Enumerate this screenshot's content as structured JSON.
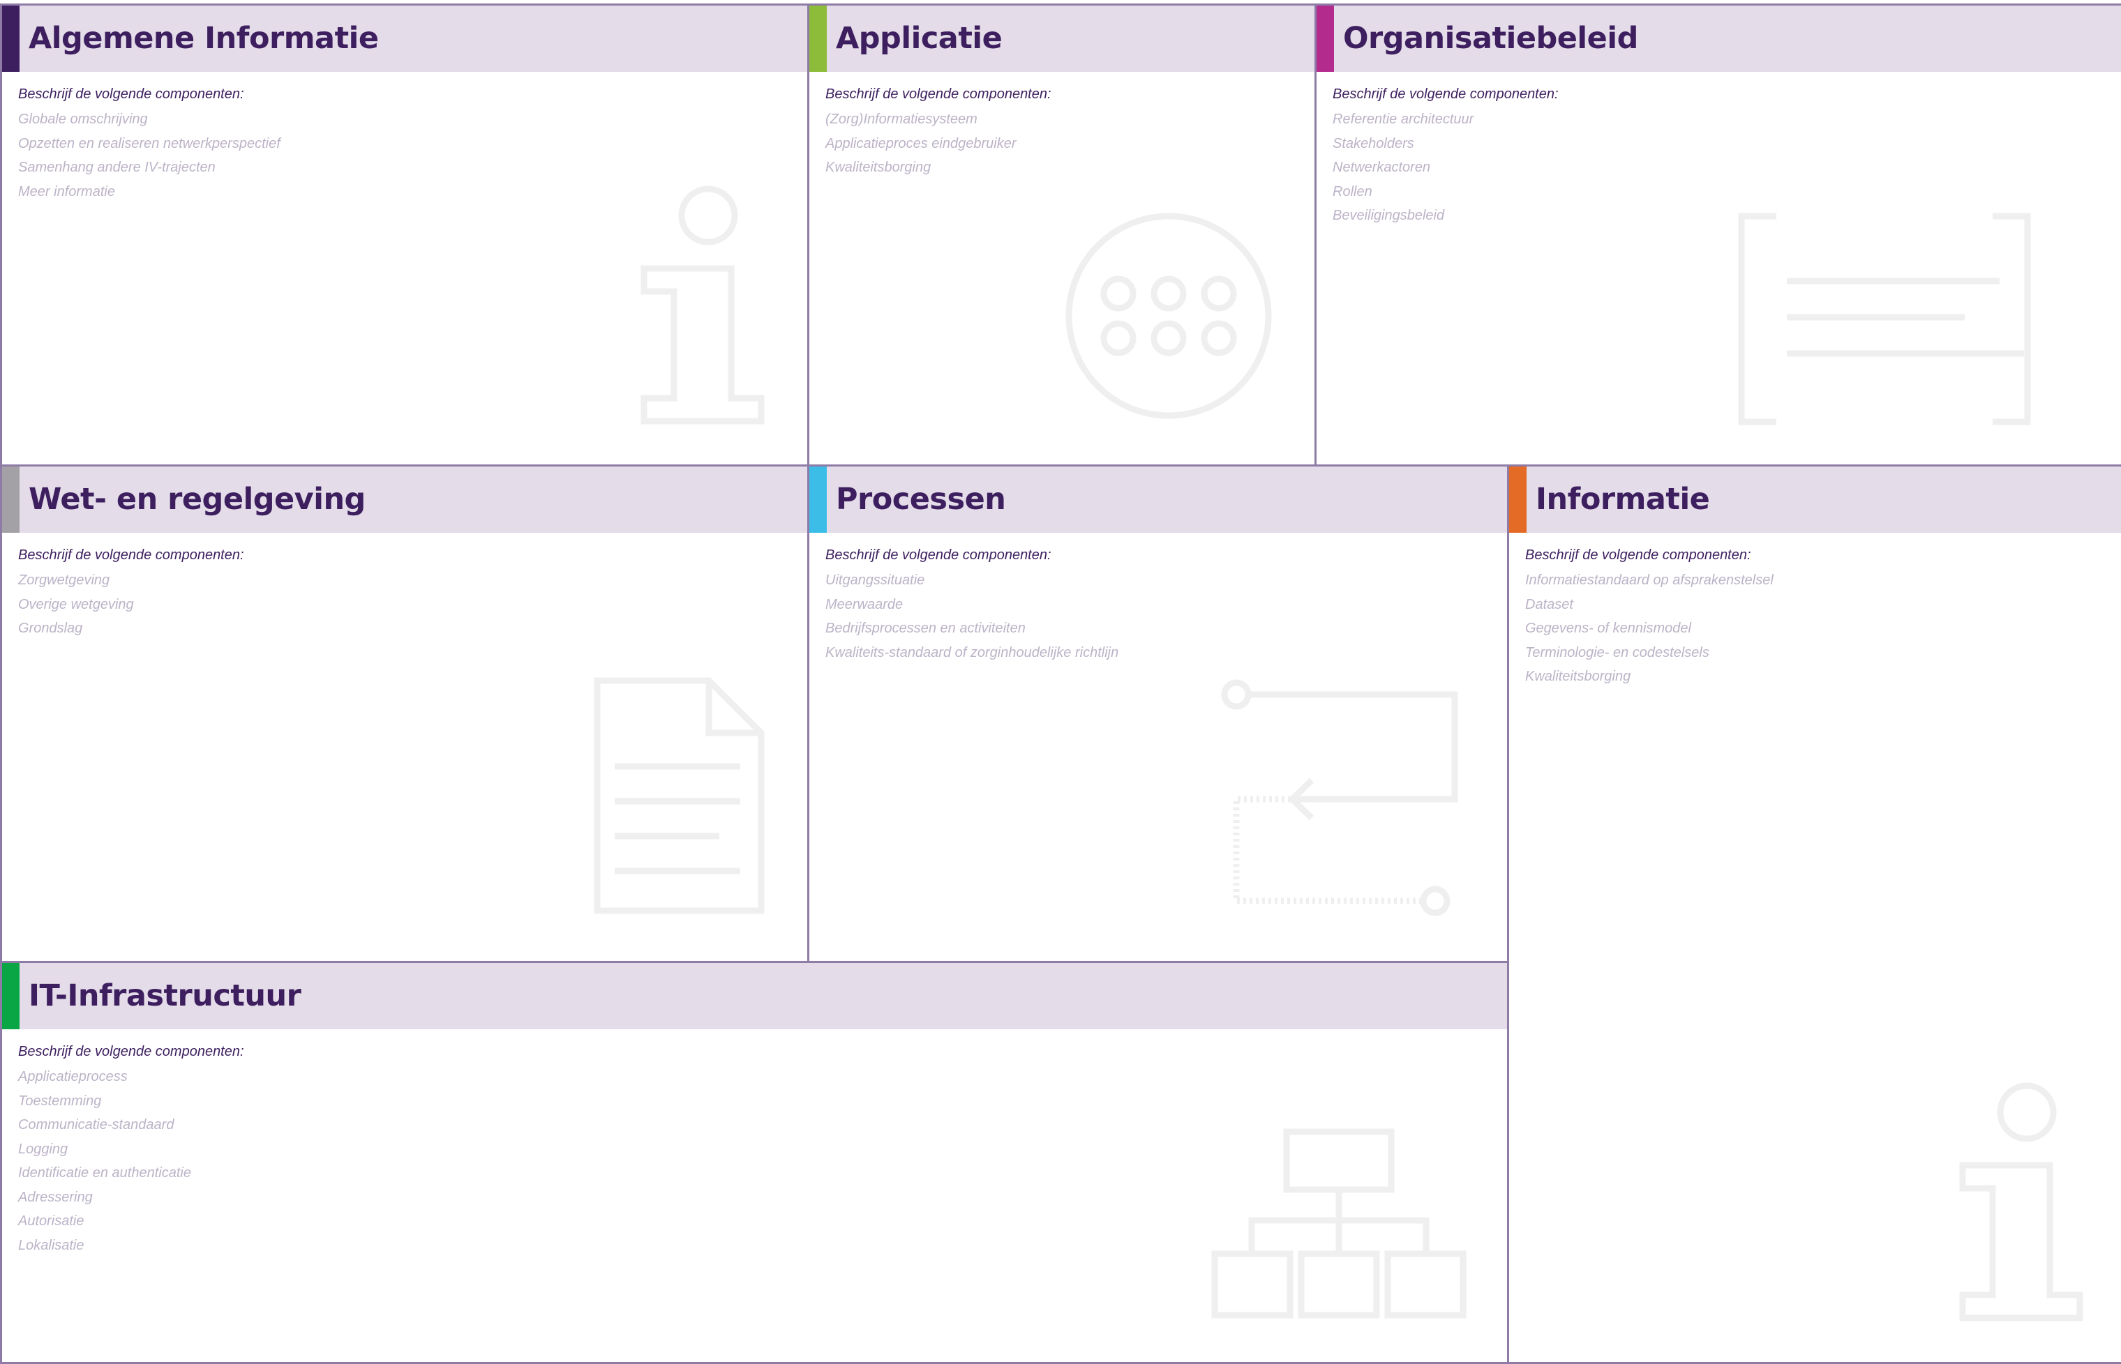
{
  "canvas": {
    "border_color": "#8e7ba6",
    "header_bg": "#e4dce8",
    "title_color": "#3d1f5f",
    "component_text_color": "#bcb3c7",
    "icon_color": "#efefef"
  },
  "panels": {
    "algemene_informatie": {
      "title": "Algemene Informatie",
      "accent_color": "#3d1f5f",
      "intro": "Beschrijf de volgende componenten:",
      "icon": "info-icon",
      "components": [
        "Globale omschrijving",
        "Opzetten en realiseren netwerkperspectief",
        "Samenhang andere IV-trajecten",
        "Meer informatie"
      ]
    },
    "applicatie": {
      "title": "Applicatie",
      "accent_color": "#8dbb3a",
      "intro": "Beschrijf de volgende componenten:",
      "icon": "application-grid-icon",
      "components": [
        "(Zorg)Informatiesysteem",
        "Applicatieproces eindgebruiker",
        "Kwaliteitsborging"
      ]
    },
    "organisatiebeleid": {
      "title": "Organisatiebeleid",
      "accent_color": "#b42b8e",
      "intro": "Beschrijf de volgende componenten:",
      "icon": "bracketed-text-icon",
      "components": [
        "Referentie architectuur",
        "Stakeholders",
        "Netwerkactoren",
        "Rollen",
        "Beveiligingsbeleid"
      ]
    },
    "wet_en_regelgeving": {
      "title": "Wet- en regelgeving",
      "accent_color": "#a3a0a6",
      "intro": "Beschrijf de volgende componenten:",
      "icon": "document-icon",
      "components": [
        "Zorgwetgeving",
        "Overige wetgeving",
        "Grondslag"
      ]
    },
    "processen": {
      "title": "Processen",
      "accent_color": "#3cbde8",
      "intro": "Beschrijf de volgende componenten:",
      "icon": "process-flow-icon",
      "components": [
        "Uitgangssituatie",
        "Meerwaarde",
        "Bedrijfsprocessen en activiteiten",
        "Kwaliteits-standaard of zorginhoudelijke richtlijn"
      ]
    },
    "informatie": {
      "title": "Informatie",
      "accent_color": "#e36b26",
      "intro": "Beschrijf de volgende componenten:",
      "icon": "info-icon",
      "components": [
        "Informatiestandaard op afsprakenstelsel",
        "Dataset",
        "Gegevens- of kennismodel",
        "Terminologie- en codestelsels",
        "Kwaliteitsborging"
      ]
    },
    "it_infrastructuur": {
      "title": "IT-Infrastructuur",
      "accent_color": "#0aa545",
      "intro": "Beschrijf de volgende componenten:",
      "icon": "hierarchy-icon",
      "components": [
        "Applicatieprocess",
        "Toestemming",
        "Communicatie-standaard",
        "Logging",
        "Identificatie en authenticatie",
        "Adressering",
        "Autorisatie",
        "Lokalisatie"
      ]
    }
  }
}
